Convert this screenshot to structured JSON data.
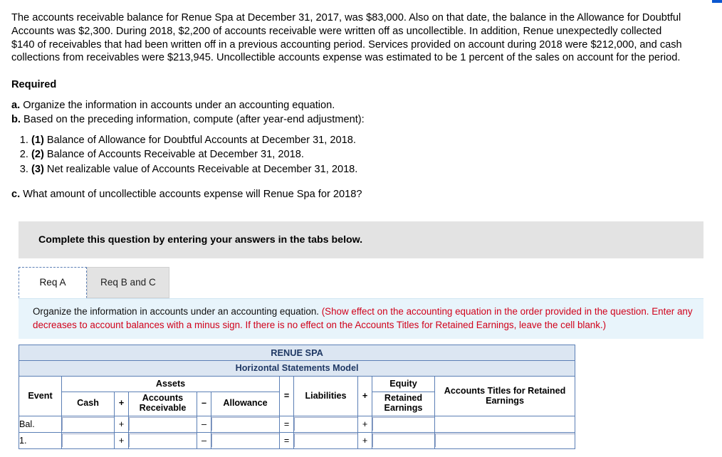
{
  "problem": {
    "paragraph": "The accounts receivable balance for Renue Spa at December 31, 2017, was $83,000. Also on that date, the balance in the Allowance for Doubtful Accounts was $2,300. During 2018, $2,200 of accounts receivable were written off as uncollectible. In addition, Renue unexpectedly collected $140 of receivables that had been written off in a previous accounting period. Services provided on account during 2018 were $212,000, and cash collections from receivables were $213,945. Uncollectible accounts expense was estimated to be 1 percent of the sales on account for the period.",
    "required_heading": "Required",
    "req_a_label": "a.",
    "req_a_text": "Organize the information in accounts under an accounting equation.",
    "req_b_label": "b.",
    "req_b_text": "Based on the preceding information, compute (after year-end adjustment):",
    "numbered": [
      {
        "marker": "(1)",
        "text": "Balance of Allowance for Doubtful Accounts at December 31, 2018."
      },
      {
        "marker": "(2)",
        "text": "Balance of Accounts Receivable at December 31, 2018."
      },
      {
        "marker": "(3)",
        "text": "Net realizable value of Accounts Receivable at December 31, 2018."
      }
    ],
    "req_c_label": "c.",
    "req_c_text": "What amount of uncollectible accounts expense will Renue Spa for 2018?"
  },
  "instruction_bar": {
    "text": "Complete this question by entering your answers in the tabs below."
  },
  "tabs": [
    {
      "label": "Req A",
      "active": true
    },
    {
      "label": "Req B and C",
      "active": false
    }
  ],
  "callout": {
    "black_text": "Organize the information in accounts under an accounting equation.",
    "red_text": "(Show effect on the accounting equation in the order provided in the question. Enter any decreases to account balances with a minus sign. If there is no effect on the Accounts Titles for Retained Earnings, leave the cell blank.)",
    "colors": {
      "black": "#111111",
      "red": "#d0021b",
      "background": "#e8f4fb"
    }
  },
  "table": {
    "title": "RENUE SPA",
    "subtitle": "Horizontal Statements Model",
    "group_headers": {
      "assets": "Assets",
      "equity": "Equity"
    },
    "columns": {
      "event": "Event",
      "cash": "Cash",
      "plus1": "+",
      "accounts_receivable": "Accounts Receivable",
      "minus": "–",
      "allowance": "Allowance",
      "equals": "=",
      "liabilities": "Liabilities",
      "plus2": "+",
      "retained_earnings": "Retained Earnings",
      "titles": "Accounts Titles for Retained Earnings"
    },
    "rows": [
      {
        "event": "Bal.",
        "cash": "",
        "accounts_receivable": "",
        "allowance": "",
        "liabilities": "",
        "retained_earnings": "",
        "titles": ""
      },
      {
        "event": "1.",
        "cash": "",
        "accounts_receivable": "",
        "allowance": "",
        "liabilities": "",
        "retained_earnings": "",
        "titles": ""
      }
    ]
  }
}
